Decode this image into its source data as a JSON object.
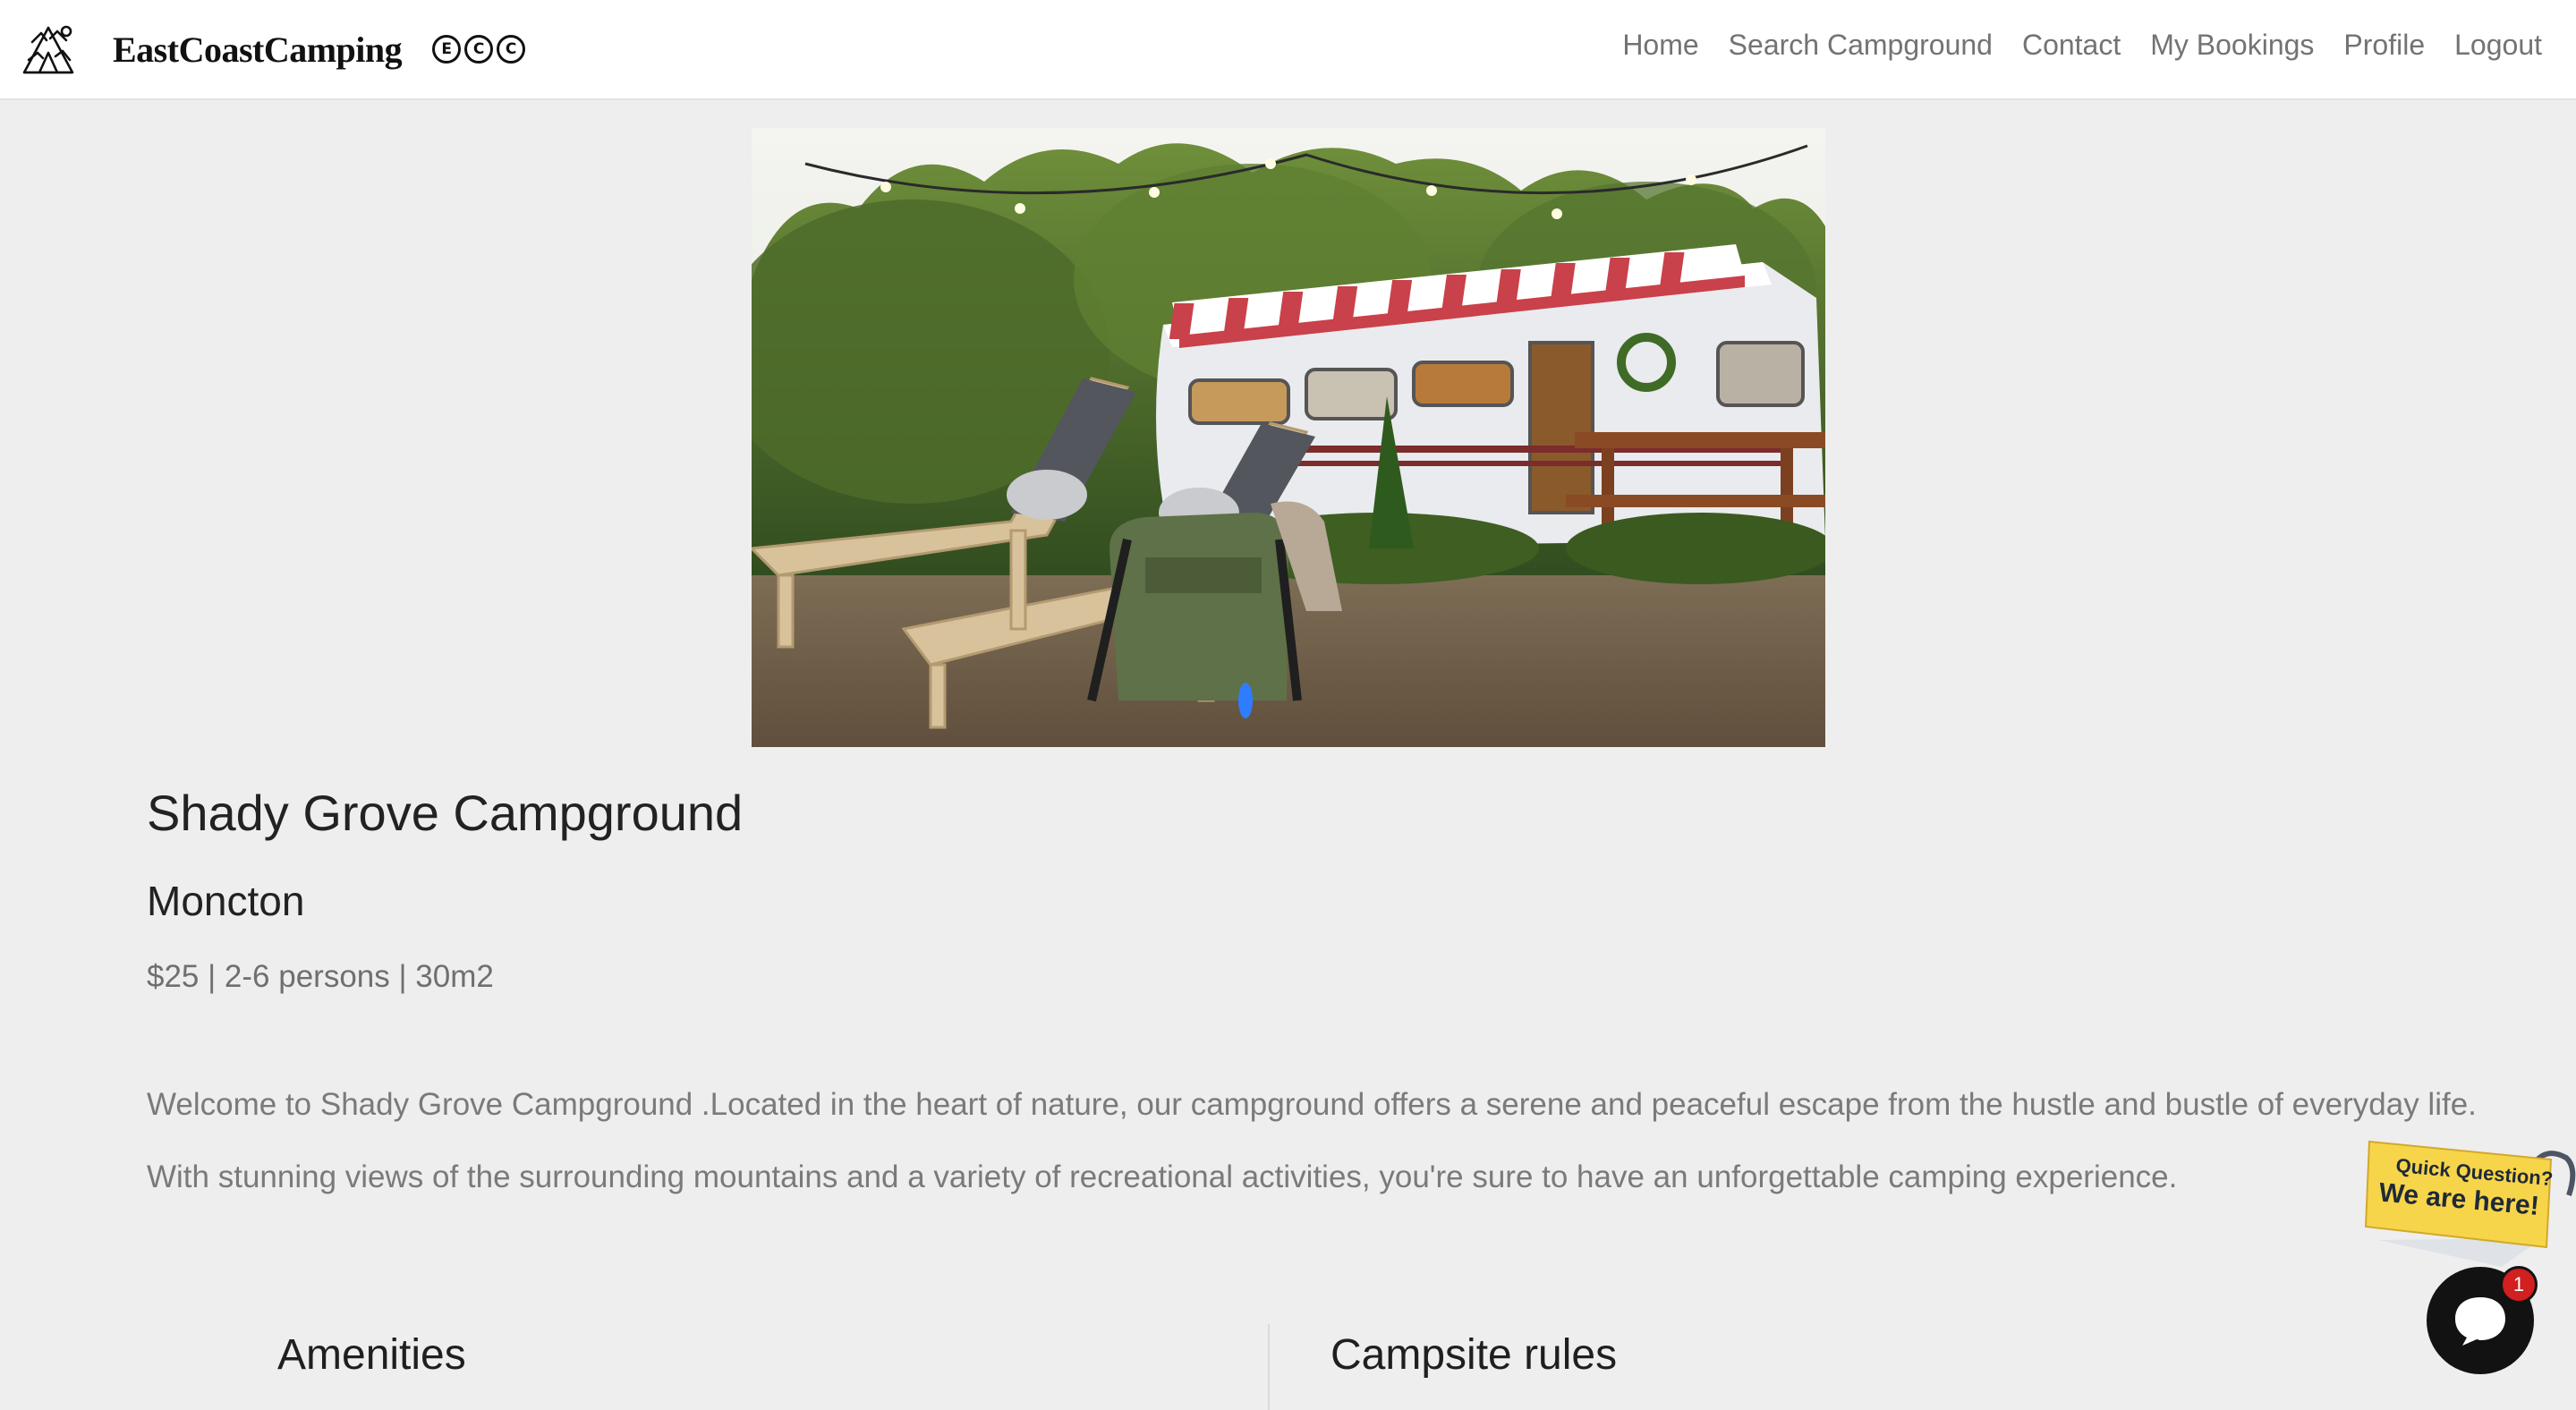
{
  "brand": {
    "name": "EastCoastCamping",
    "marks": [
      "E",
      "C",
      "C"
    ]
  },
  "nav": {
    "items": [
      {
        "label": "Home"
      },
      {
        "label": "Search Campground"
      },
      {
        "label": "Contact"
      },
      {
        "label": "My Bookings"
      },
      {
        "label": "Profile"
      },
      {
        "label": "Logout"
      }
    ]
  },
  "campground": {
    "name": "Shady Grove Campground",
    "city": "Moncton",
    "meta": "$25 | 2-6 persons | 30m2",
    "description_line1": "Welcome to Shady Grove Campground .Located in the heart of nature, our campground offers a serene and peaceful escape from the hustle and bustle of everyday life.",
    "description_line2": "With stunning views of the surrounding mountains and a variety of recreational activities, you're sure to have an unforgettable camping experience."
  },
  "sections": {
    "amenities_heading": "Amenities",
    "rules_heading": "Campsite rules"
  },
  "chat": {
    "badge_line1": "Quick Question?",
    "badge_line2": "We are here!",
    "unread_count": "1"
  },
  "icons": {
    "logo": "camping-tent-logo-icon",
    "chat": "chat-bubble-icon"
  },
  "colors": {
    "nav_text": "#737373",
    "page_bg": "#eeeeee",
    "chat_badge": "#f7d54a",
    "notification": "#d21f1f"
  }
}
